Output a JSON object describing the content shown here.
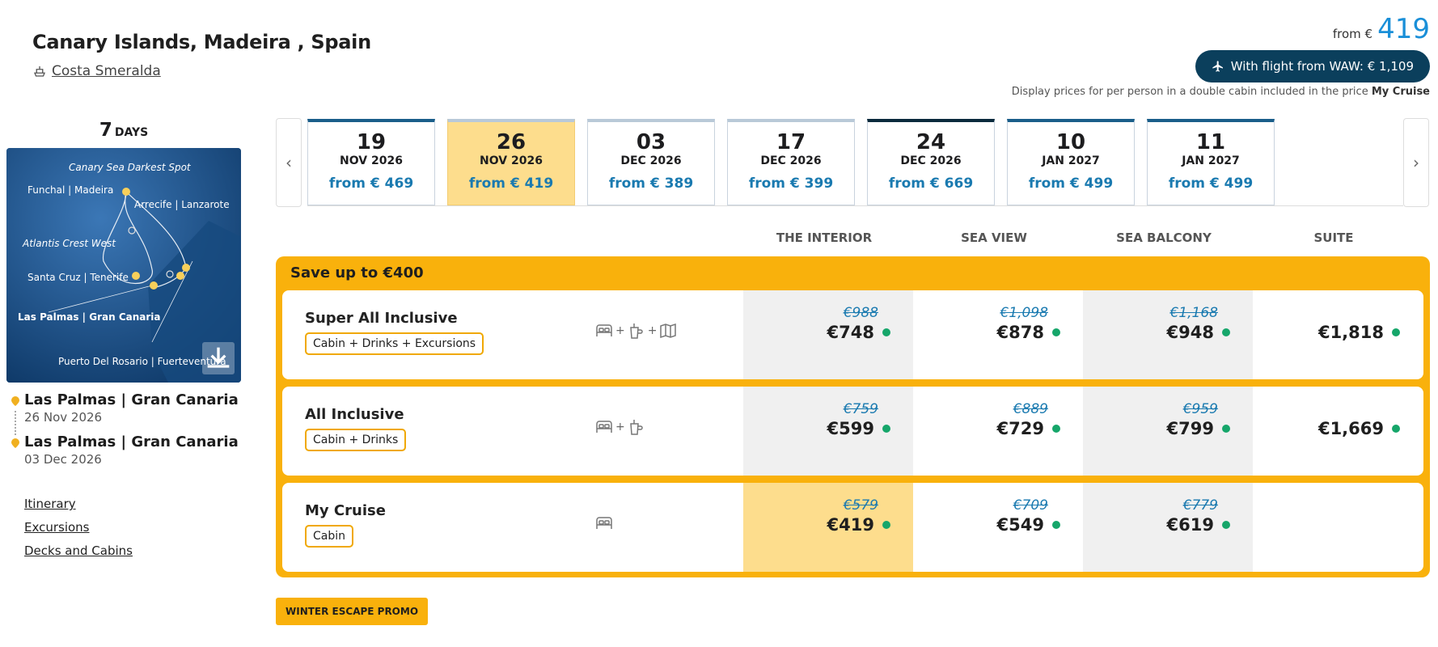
{
  "header": {
    "title": "Canary Islands, Madeira , Spain",
    "ship": "Costa Smeralda",
    "from_label": "from €",
    "from_value": "419",
    "flight_button": "With flight from WAW: € 1,109",
    "disclaimer": "Display prices for per person in a double cabin included in the price",
    "disclaimer_bold": "My Cruise"
  },
  "sidebar": {
    "days_number": "7",
    "days_unit": "DAYS",
    "map_labels": {
      "l1": "Canary Sea Darkest Spot",
      "l2": "Funchal | Madeira",
      "l3": "Arrecife | Lanzarote",
      "l4": "Atlantis Crest West",
      "l5": "Santa Cruz | Tenerife",
      "l6": "Las Palmas | Gran Canaria",
      "l7": "Puerto Del Rosario | Fuerteventura"
    },
    "ports": [
      {
        "name": "Las Palmas | Gran Canaria",
        "date": "26 Nov 2026"
      },
      {
        "name": "Las Palmas | Gran Canaria",
        "date": "03 Dec 2026"
      }
    ],
    "links": [
      "Itinerary",
      "Excursions",
      "Decks and Cabins"
    ]
  },
  "dates": [
    {
      "day": "19",
      "monthyear": "NOV 2026",
      "price": "from € 469"
    },
    {
      "day": "26",
      "monthyear": "NOV 2026",
      "price": "from € 419"
    },
    {
      "day": "03",
      "monthyear": "DEC 2026",
      "price": "from € 389"
    },
    {
      "day": "17",
      "monthyear": "DEC 2026",
      "price": "from € 399"
    },
    {
      "day": "24",
      "monthyear": "DEC 2026",
      "price": "from € 669"
    },
    {
      "day": "10",
      "monthyear": "JAN 2027",
      "price": "from € 499"
    },
    {
      "day": "11",
      "monthyear": "JAN 2027",
      "price": "from € 499"
    }
  ],
  "columns": [
    "THE INTERIOR",
    "SEA VIEW",
    "SEA BALCONY",
    "SUITE"
  ],
  "save_banner": "Save up to €400",
  "packages": [
    {
      "name": "Super All Inclusive",
      "tag": "Cabin + Drinks + Excursions",
      "prices": [
        {
          "old": "€988",
          "new": "€748"
        },
        {
          "old": "€1,098",
          "new": "€878"
        },
        {
          "old": "€1,168",
          "new": "€948"
        },
        {
          "old": "",
          "new": "€1,818"
        }
      ]
    },
    {
      "name": "All Inclusive",
      "tag": "Cabin + Drinks",
      "prices": [
        {
          "old": "€759",
          "new": "€599"
        },
        {
          "old": "€889",
          "new": "€729"
        },
        {
          "old": "€959",
          "new": "€799"
        },
        {
          "old": "",
          "new": "€1,669"
        }
      ]
    },
    {
      "name": "My Cruise",
      "tag": "Cabin",
      "prices": [
        {
          "old": "€579",
          "new": "€419"
        },
        {
          "old": "€709",
          "new": "€549"
        },
        {
          "old": "€779",
          "new": "€619"
        },
        {
          "old": "",
          "new": ""
        }
      ]
    }
  ],
  "icons": {
    "plus": "+"
  },
  "promo": "WINTER ESCAPE PROMO",
  "colors": {
    "accent": "#f9b10c",
    "brand_dark": "#0b3f5c",
    "price_blue": "#1a7ab0",
    "available": "#16a66a",
    "selected": "#fddd8d"
  }
}
